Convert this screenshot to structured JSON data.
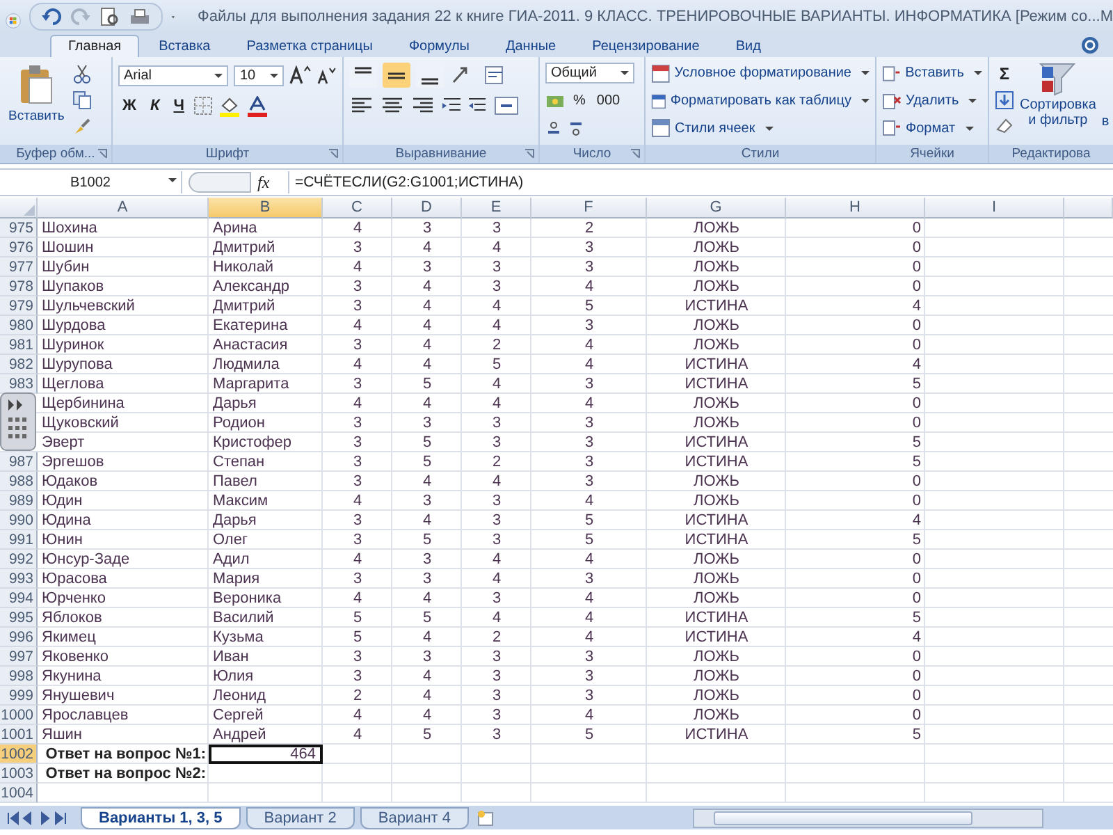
{
  "title_bar": {
    "title": "Файлы для выполнения задания 22 к книге ГИА-2011. 9 КЛАСС. ТРЕНИРОВОЧНЫЕ ВАРИАНТЫ. ИНФОРМАТИКА  [Режим со...М"
  },
  "ribbon_tabs": [
    {
      "label": "Главная",
      "selected": true
    },
    {
      "label": "Вставка",
      "selected": false
    },
    {
      "label": "Разметка страницы",
      "selected": false
    },
    {
      "label": "Формулы",
      "selected": false
    },
    {
      "label": "Данные",
      "selected": false
    },
    {
      "label": "Рецензирование",
      "selected": false
    },
    {
      "label": "Вид",
      "selected": false
    }
  ],
  "ribbon": {
    "clipboard": {
      "paste": "Вставить",
      "label": "Буфер обм..."
    },
    "font": {
      "name": "Arial",
      "size": "10",
      "styles": [
        {
          "kind": "bold",
          "label": "Ж"
        },
        {
          "kind": "italic",
          "label": "К"
        },
        {
          "kind": "underline",
          "label": "Ч"
        }
      ],
      "label": "Шрифт"
    },
    "alignment": {
      "vertical": [
        {
          "selected": false
        },
        {
          "selected": true
        },
        {
          "selected": false
        }
      ],
      "label": "Выравнивание"
    },
    "number": {
      "format": "Общий",
      "percent": "%",
      "thousands": "000",
      "label": "Число"
    },
    "styles": {
      "items": [
        "Условное форматирование",
        "Форматировать как таблицу",
        "Стили ячеек"
      ],
      "label": "Стили"
    },
    "cells": {
      "items": [
        "Вставить",
        "Удалить",
        "Формат"
      ],
      "label": "Ячейки"
    },
    "editing": {
      "sigma": "Σ",
      "sort": "Сортировка",
      "sort_line2": "и фильтр",
      "next": "в",
      "label": "Редактирова"
    }
  },
  "formula_bar": {
    "name_box": "B1002",
    "fx": "fx",
    "formula": "=СЧЁТЕСЛИ(G2:G1001;ИСТИНА)"
  },
  "sheet": {
    "columns": [
      {
        "label": "A",
        "selected": false
      },
      {
        "label": "B",
        "selected": true
      },
      {
        "label": "C",
        "selected": false
      },
      {
        "label": "D",
        "selected": false
      },
      {
        "label": "E",
        "selected": false
      },
      {
        "label": "F",
        "selected": false
      },
      {
        "label": "G",
        "selected": false
      },
      {
        "label": "H",
        "selected": false
      },
      {
        "label": "I",
        "selected": false
      }
    ],
    "rows": [
      {
        "row": "975",
        "cells": [
          "Шохина",
          "Арина",
          "4",
          "3",
          "3",
          "2",
          "ЛОЖЬ",
          "0"
        ]
      },
      {
        "row": "976",
        "cells": [
          "Шошин",
          "Дмитрий",
          "3",
          "4",
          "4",
          "3",
          "ЛОЖЬ",
          "0"
        ]
      },
      {
        "row": "977",
        "cells": [
          "Шубин",
          "Николай",
          "4",
          "3",
          "3",
          "3",
          "ЛОЖЬ",
          "0"
        ]
      },
      {
        "row": "978",
        "cells": [
          "Шупаков",
          "Александр",
          "3",
          "4",
          "3",
          "4",
          "ЛОЖЬ",
          "0"
        ]
      },
      {
        "row": "979",
        "cells": [
          "Шульчевский",
          "Дмитрий",
          "3",
          "4",
          "4",
          "5",
          "ИСТИНА",
          "4"
        ]
      },
      {
        "row": "980",
        "cells": [
          "Шурдова",
          "Екатерина",
          "4",
          "4",
          "4",
          "3",
          "ЛОЖЬ",
          "0"
        ]
      },
      {
        "row": "981",
        "cells": [
          "Шуринок",
          "Анастасия",
          "3",
          "4",
          "2",
          "4",
          "ЛОЖЬ",
          "0"
        ]
      },
      {
        "row": "982",
        "cells": [
          "Шурупова",
          "Людмила",
          "4",
          "4",
          "5",
          "4",
          "ИСТИНА",
          "4"
        ]
      },
      {
        "row": "983",
        "cells": [
          "Щеглова",
          "Маргарита",
          "3",
          "5",
          "4",
          "3",
          "ИСТИНА",
          "5"
        ]
      },
      {
        "cells": [
          "Щербинина",
          "Дарья",
          "4",
          "4",
          "4",
          "4",
          "ЛОЖЬ",
          "0"
        ]
      },
      {
        "cells": [
          "Щуковский",
          "Родион",
          "3",
          "3",
          "3",
          "3",
          "ЛОЖЬ",
          "0"
        ]
      },
      {
        "cells": [
          "Эверт",
          "Кристофер",
          "3",
          "5",
          "3",
          "3",
          "ИСТИНА",
          "5"
        ]
      },
      {
        "row": "987",
        "cells": [
          "Эргешов",
          "Степан",
          "3",
          "5",
          "2",
          "3",
          "ИСТИНА",
          "5"
        ]
      },
      {
        "row": "988",
        "cells": [
          "Юдаков",
          "Павел",
          "3",
          "4",
          "4",
          "3",
          "ЛОЖЬ",
          "0"
        ]
      },
      {
        "row": "989",
        "cells": [
          "Юдин",
          "Максим",
          "4",
          "3",
          "3",
          "4",
          "ЛОЖЬ",
          "0"
        ]
      },
      {
        "row": "990",
        "cells": [
          "Юдина",
          "Дарья",
          "3",
          "4",
          "3",
          "5",
          "ИСТИНА",
          "4"
        ]
      },
      {
        "row": "991",
        "cells": [
          "Юнин",
          "Олег",
          "3",
          "5",
          "3",
          "5",
          "ИСТИНА",
          "5"
        ]
      },
      {
        "row": "992",
        "cells": [
          "Юнсур-Заде",
          "Адил",
          "4",
          "3",
          "4",
          "4",
          "ЛОЖЬ",
          "0"
        ]
      },
      {
        "row": "993",
        "cells": [
          "Юрасова",
          "Мария",
          "3",
          "3",
          "4",
          "3",
          "ЛОЖЬ",
          "0"
        ]
      },
      {
        "row": "994",
        "cells": [
          "Юрченко",
          "Вероника",
          "4",
          "4",
          "3",
          "4",
          "ЛОЖЬ",
          "0"
        ]
      },
      {
        "row": "995",
        "cells": [
          "Яблоков",
          "Василий",
          "5",
          "5",
          "4",
          "4",
          "ИСТИНА",
          "5"
        ]
      },
      {
        "row": "996",
        "cells": [
          "Якимец",
          "Кузьма",
          "5",
          "4",
          "2",
          "4",
          "ИСТИНА",
          "4"
        ]
      },
      {
        "row": "997",
        "cells": [
          "Яковенко",
          "Иван",
          "3",
          "3",
          "3",
          "3",
          "ЛОЖЬ",
          "0"
        ]
      },
      {
        "row": "998",
        "cells": [
          "Якунина",
          "Юлия",
          "3",
          "4",
          "3",
          "3",
          "ЛОЖЬ",
          "0"
        ]
      },
      {
        "row": "999",
        "cells": [
          "Янушевич",
          "Леонид",
          "2",
          "4",
          "3",
          "3",
          "ЛОЖЬ",
          "0"
        ]
      },
      {
        "row": "1000",
        "cells": [
          "Ярославцев",
          "Сергей",
          "4",
          "4",
          "3",
          "4",
          "ЛОЖЬ",
          "0"
        ]
      },
      {
        "row": "1001",
        "cells": [
          "Яшин",
          "Андрей",
          "4",
          "5",
          "3",
          "5",
          "ИСТИНА",
          "5"
        ]
      }
    ],
    "answers": [
      {
        "row": "1002",
        "label": "Ответ на вопрос №1:",
        "value": "464",
        "selected": true
      },
      {
        "row": "1003",
        "label": "Ответ на вопрос №2:",
        "selected": false
      }
    ],
    "blank_rows": [
      "1004"
    ]
  },
  "sheet_tabs": [
    {
      "label": "Варианты 1, 3, 5",
      "selected": true
    },
    {
      "label": "Вариант 2",
      "selected": false
    },
    {
      "label": "Вариант 4",
      "selected": false
    }
  ]
}
